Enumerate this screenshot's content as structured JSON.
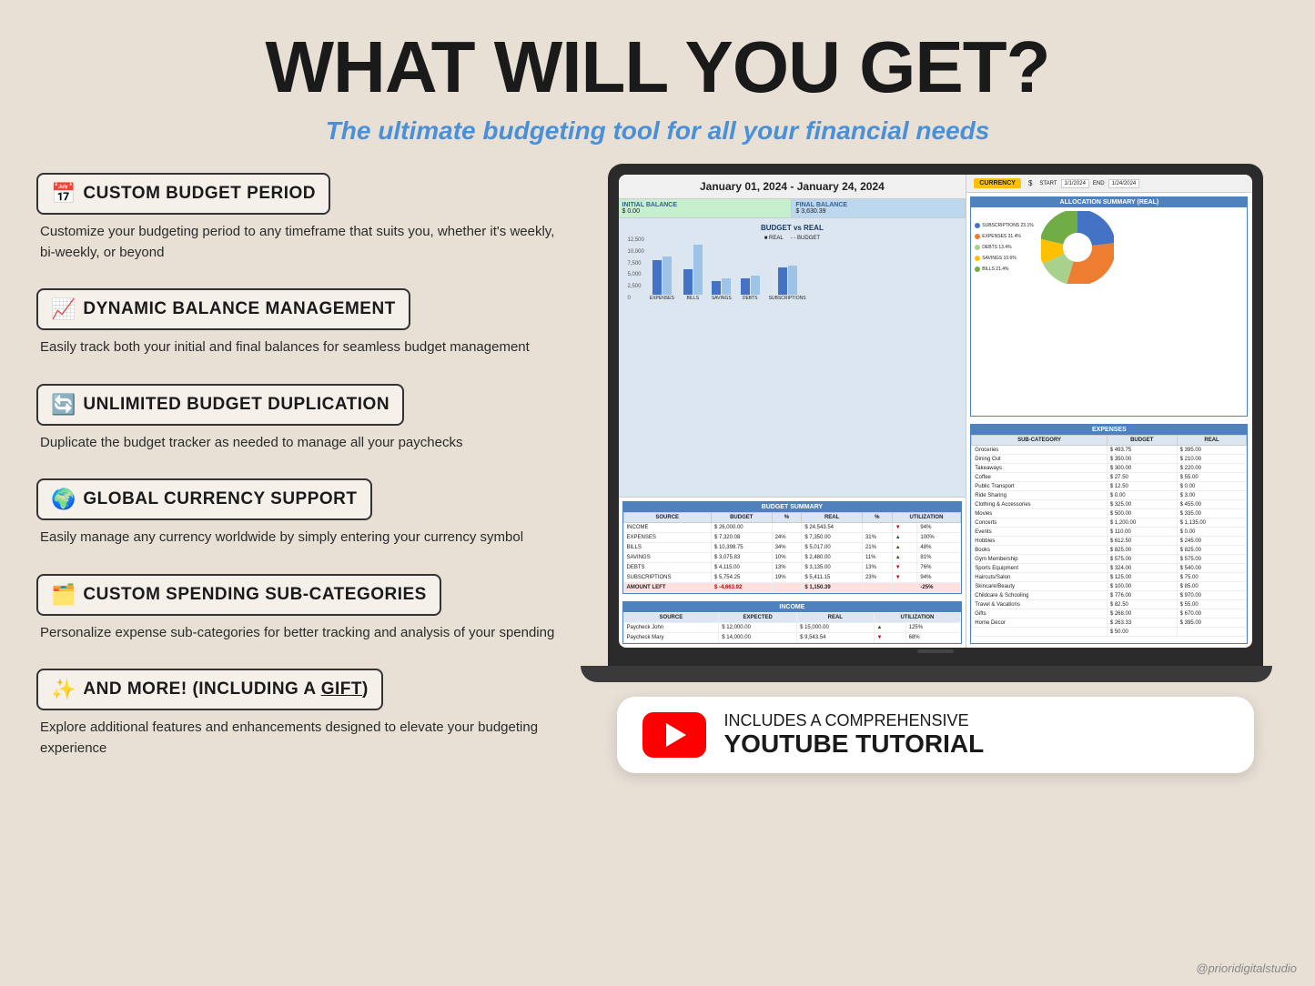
{
  "page": {
    "bg_color": "#e8e0d5",
    "title": "WHAT WILL YOU GET?",
    "subtitle": "The ultimate budgeting tool for all your financial needs",
    "watermark": "@prioridigitalstudio"
  },
  "features": [
    {
      "icon": "📅",
      "title": "CUSTOM BUDGET PERIOD",
      "desc": "Customize your budgeting period to any timeframe that suits you, whether it's weekly, bi-weekly, or beyond"
    },
    {
      "icon": "📈",
      "title": "DYNAMIC BALANCE MANAGEMENT",
      "desc": "Easily track both your initial and final balances for seamless budget management"
    },
    {
      "icon": "🔄",
      "title": "UNLIMITED BUDGET DUPLICATION",
      "desc": "Duplicate the budget tracker as needed to manage all your paychecks"
    },
    {
      "icon": "🌍",
      "title": "GLOBAL CURRENCY SUPPORT",
      "desc": "Easily manage any currency worldwide by simply entering your currency symbol"
    },
    {
      "icon": "🗂️",
      "title": "CUSTOM SPENDING SUB-CATEGORIES",
      "desc": "Personalize expense sub-categories for better tracking and analysis of your spending"
    },
    {
      "icon": "✨",
      "title": "AND MORE! (INCLUDING A GIFT)",
      "desc": "Explore additional features and enhancements designed to elevate your budgeting experience"
    }
  ],
  "spreadsheet": {
    "date_range": "January 01, 2024 - January 24, 2024",
    "initial_balance_label": "INITIAL BALANCE",
    "initial_balance_value": "$ 0.00",
    "final_balance_label": "FINAL BALANCE",
    "final_balance_value": "$ 3,630.39",
    "chart_title": "BUDGET vs REAL",
    "chart_legend_real": "REAL",
    "chart_legend_budget": "BUDGET",
    "chart_y_values": [
      "12,500",
      "10,000",
      "7,500",
      "5,000",
      "2,500",
      "0"
    ],
    "chart_categories": [
      "EXPENSES",
      "BILLS",
      "SAVINGS",
      "DEBTS",
      "SUBSCRIPTIONS"
    ],
    "budget_summary_title": "BUDGET SUMMARY",
    "budget_summary_headers": [
      "SOURCE",
      "BUDGET",
      "%",
      "REAL",
      "%",
      "UTILIZATION"
    ],
    "budget_summary_rows": [
      [
        "INCOME",
        "$ 26,000.00",
        "",
        "$ 24,543.54",
        "",
        "▼",
        "94%"
      ],
      [
        "EXPENSES",
        "$ 7,320.08",
        "24%",
        "$ 7,350.00",
        "31%",
        "▲",
        "100%"
      ],
      [
        "BILLS",
        "$ 10,398.75",
        "34%",
        "$ 5,017.00",
        "21%",
        "▲",
        "48%"
      ],
      [
        "SAVINGS",
        "$ 3,075.83",
        "10%",
        "$ 2,480.00",
        "11%",
        "▲",
        "81%"
      ],
      [
        "DEBTS",
        "$ 4,115.00",
        "13%",
        "$ 3,135.00",
        "13%",
        "▼",
        "76%"
      ],
      [
        "SUBSCRIPTIONS",
        "$ 5,754.25",
        "19%",
        "$ 5,411.15",
        "23%",
        "▼",
        "94%"
      ],
      [
        "AMOUNT LEFT",
        "$ -4,663.92",
        "",
        "$ 1,150.39",
        "",
        "",
        "-25%"
      ]
    ],
    "income_title": "INCOME",
    "income_headers": [
      "SOURCE",
      "EXPECTED",
      "REAL",
      "UTILIZATION"
    ],
    "income_rows": [
      [
        "Paycheck John",
        "$ 12,000.00",
        "$ 15,000.00",
        "▲",
        "125%"
      ],
      [
        "Paycheck Mary",
        "$ 14,000.00",
        "$ 9,543.54",
        "▼",
        "68%"
      ]
    ],
    "currency_label": "CURRENCY",
    "currency_value": "$",
    "start_label": "START",
    "start_value": "1/1/2024",
    "end_label": "END",
    "end_value": "1/24/2024",
    "allocation_title": "ALLOCATION SUMMARY (REAL)",
    "allocation_segments": [
      {
        "label": "SUBSCRIPTIONS",
        "pct": "23.1%",
        "color": "#4472c4"
      },
      {
        "label": "EXPENSES",
        "pct": "31.4%",
        "color": "#ed7d31"
      },
      {
        "label": "BILLS",
        "pct": "21.4%",
        "color": "#a9d18e"
      },
      {
        "label": "SAVINGS",
        "pct": "10.6%",
        "color": "#ffc000"
      },
      {
        "label": "DEBTS",
        "pct": "13.4%",
        "color": "#70ad47"
      }
    ],
    "expenses_title": "EXPENSES",
    "expenses_headers": [
      "SUB-CATEGORY",
      "BUDGET",
      "REAL"
    ],
    "expenses_rows": [
      [
        "Groceries",
        "$ 493.75",
        "$ 395.00"
      ],
      [
        "Dining Out",
        "$ 350.00",
        "$ 210.00"
      ],
      [
        "Takeaways",
        "$ 300.00",
        "$ 220.00"
      ],
      [
        "Coffee",
        "$ 27.50",
        "$ 55.00"
      ],
      [
        "Public Transport",
        "$ 12.50",
        "$ 0.00"
      ],
      [
        "Ride Sharing",
        "$ 0.00",
        "$ 3.00"
      ],
      [
        "Clothing & Accessories",
        "$ 325.00",
        "$ 455.00"
      ],
      [
        "Movies",
        "$ 500.00",
        "$ 335.00"
      ],
      [
        "Concerts",
        "$ 1,200.00",
        "$ 1,135.00"
      ],
      [
        "Events",
        "$ 110.00",
        "$ 0.00"
      ],
      [
        "Hobbies",
        "$ 612.50",
        "$ 245.00"
      ],
      [
        "Books",
        "$ 825.00",
        "$ 825.00"
      ],
      [
        "Gym Membership",
        "$ 575.00",
        "$ 575.00"
      ],
      [
        "Sports Equipment",
        "$ 324.00",
        "$ 540.00"
      ],
      [
        "Haircuts/Salon",
        "$ 125.00",
        "$ 75.00"
      ],
      [
        "Skincare/Beauty",
        "$ 100.00",
        "$ 85.00"
      ],
      [
        "Childcare & Schooling",
        "$ 776.00",
        "$ 970.00"
      ],
      [
        "Travel & Vacations",
        "$ 82.50",
        "$ 55.00"
      ],
      [
        "Gifts",
        "$ 268.00",
        "$ 670.00"
      ],
      [
        "Home Decor",
        "$ 263.33",
        "$ 395.00"
      ],
      [
        "",
        "$ 50.00",
        ""
      ]
    ]
  },
  "youtube": {
    "line1": "INCLUDES A COMPREHENSIVE",
    "line2": "YOUTUBE TUTORIAL"
  }
}
